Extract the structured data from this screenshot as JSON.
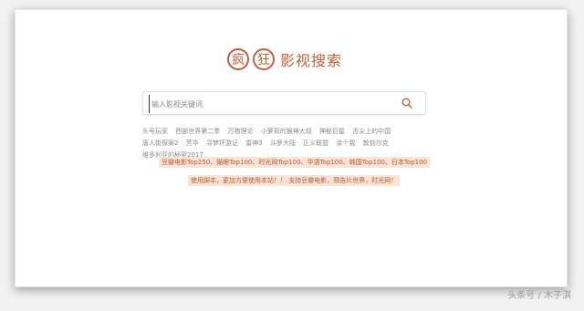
{
  "logo": {
    "seal1": "疯",
    "seal2": "狂",
    "text": "影视搜索"
  },
  "search": {
    "placeholder": "输入影视关键词",
    "value": ""
  },
  "hot_tags": [
    "头号玩家",
    "西部世界第二季",
    "万物理论",
    "小萝莉的猴神大叔",
    "神秘巨星",
    "舌尖上的中国",
    "唐人街探案2",
    "芳华",
    "寻梦环游记",
    "雷神3",
    "斗罗大陆",
    "正义联盟",
    "涂个我",
    "敦刻尔克",
    "维多利亚的秘密2017"
  ],
  "badges": {
    "sources": "豆瓣电影Top250、猫眼Top100、时光网Top100、华语Top100、韩国Top100、日本Top100",
    "notice": "使用脚本，更加方便使用本站！！ 支持豆瓣电影，预告片世界，时光网！"
  },
  "watermark": "头条号 / 木子淇",
  "colors": {
    "accent": "#c0603a",
    "badge_bg": "#fbe3d6",
    "badge_text": "#b55a37"
  }
}
